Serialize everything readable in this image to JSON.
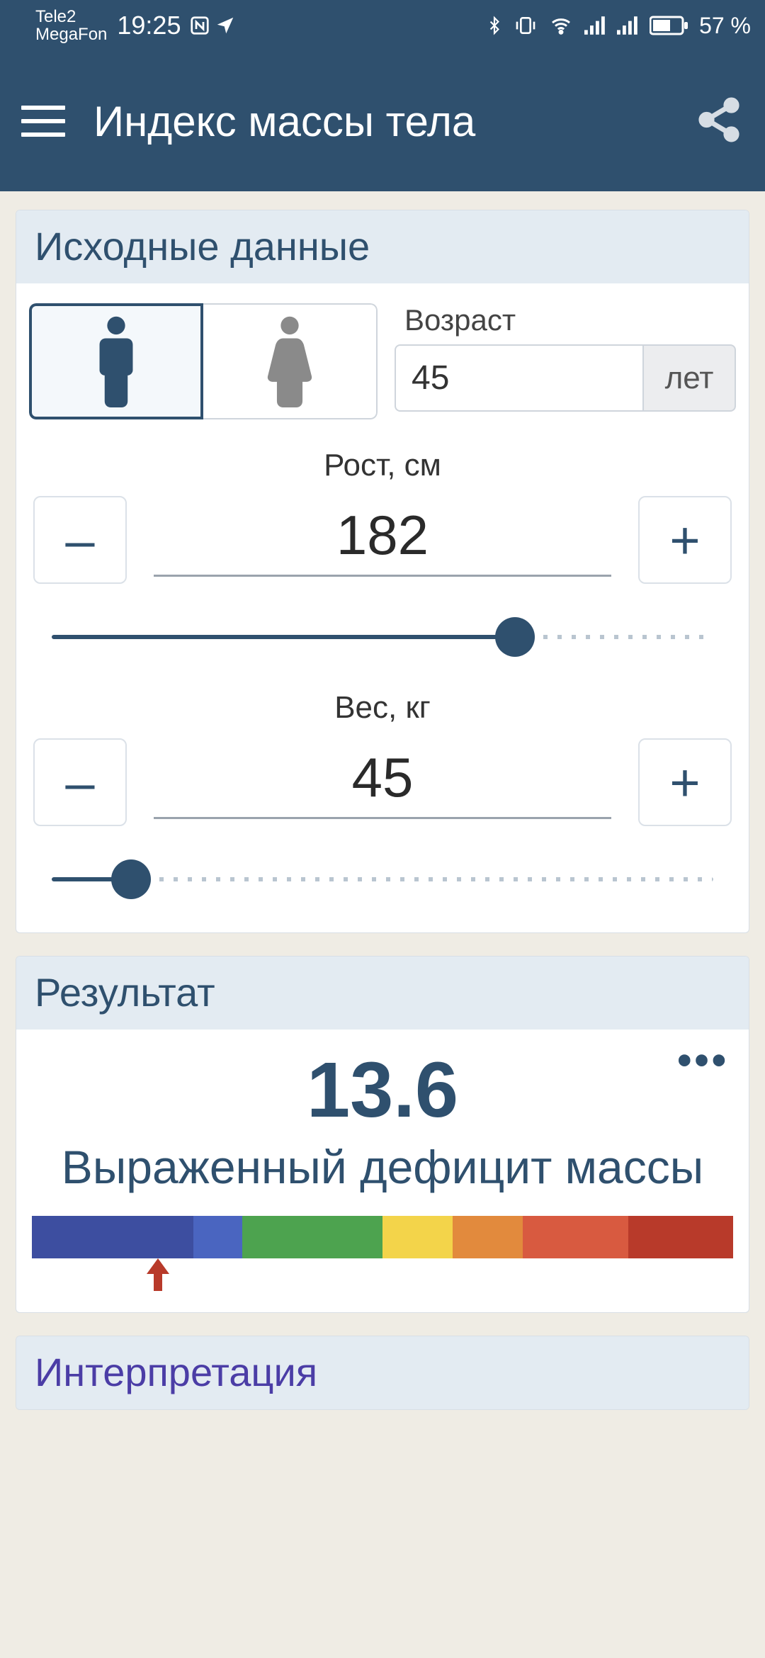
{
  "status": {
    "carrier1": "Tele2",
    "carrier2": "MegaFon",
    "time": "19:25",
    "battery": "57 %"
  },
  "header": {
    "title": "Индекс массы тела"
  },
  "input_card": {
    "title": "Исходные данные",
    "age_label": "Возраст",
    "age_value": "45",
    "age_unit": "лет",
    "height_label": "Рост, см",
    "height_value": "182",
    "height_slider_percent": 70,
    "weight_label": "Вес, кг",
    "weight_value": "45",
    "weight_slider_percent": 12,
    "minus": "–",
    "plus": "+"
  },
  "result_card": {
    "title": "Результат",
    "value": "13.6",
    "description": "Выраженный дефицит массы",
    "arrow_percent": 18,
    "segments": [
      {
        "color": "#3d4ea0",
        "weight": 23
      },
      {
        "color": "#4a65c0",
        "weight": 7
      },
      {
        "color": "#4da34f",
        "weight": 20
      },
      {
        "color": "#f3d44a",
        "weight": 10
      },
      {
        "color": "#e28a3d",
        "weight": 10
      },
      {
        "color": "#d85a40",
        "weight": 15
      },
      {
        "color": "#b83a2a",
        "weight": 15
      }
    ]
  },
  "interp_card": {
    "title": "Интерпретация"
  }
}
